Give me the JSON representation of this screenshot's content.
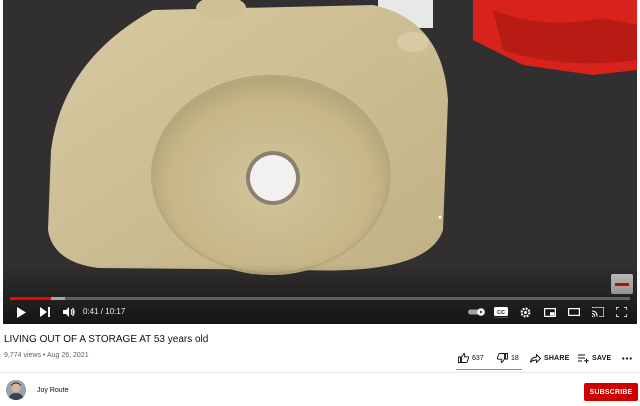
{
  "player": {
    "current_time": "0:41",
    "separator": " / ",
    "duration": "10:17",
    "played_fraction": 0.066,
    "loaded_fraction": 0.088,
    "colors": {
      "progress": "#ff0000",
      "background": "#2e2c2c"
    }
  },
  "video": {
    "title": "LIVING OUT OF A STORAGE AT 53 years old",
    "views": "9,774 views",
    "meta_separator": " • ",
    "date": "Aug 26, 2021"
  },
  "actions": {
    "likes": "637",
    "dislikes": "18",
    "share_label": "SHARE",
    "save_label": "SAVE"
  },
  "channel": {
    "name": "Joy Route",
    "subscribe_label": "SUBSCRIBE",
    "subscribe_color": "#cc0000"
  }
}
